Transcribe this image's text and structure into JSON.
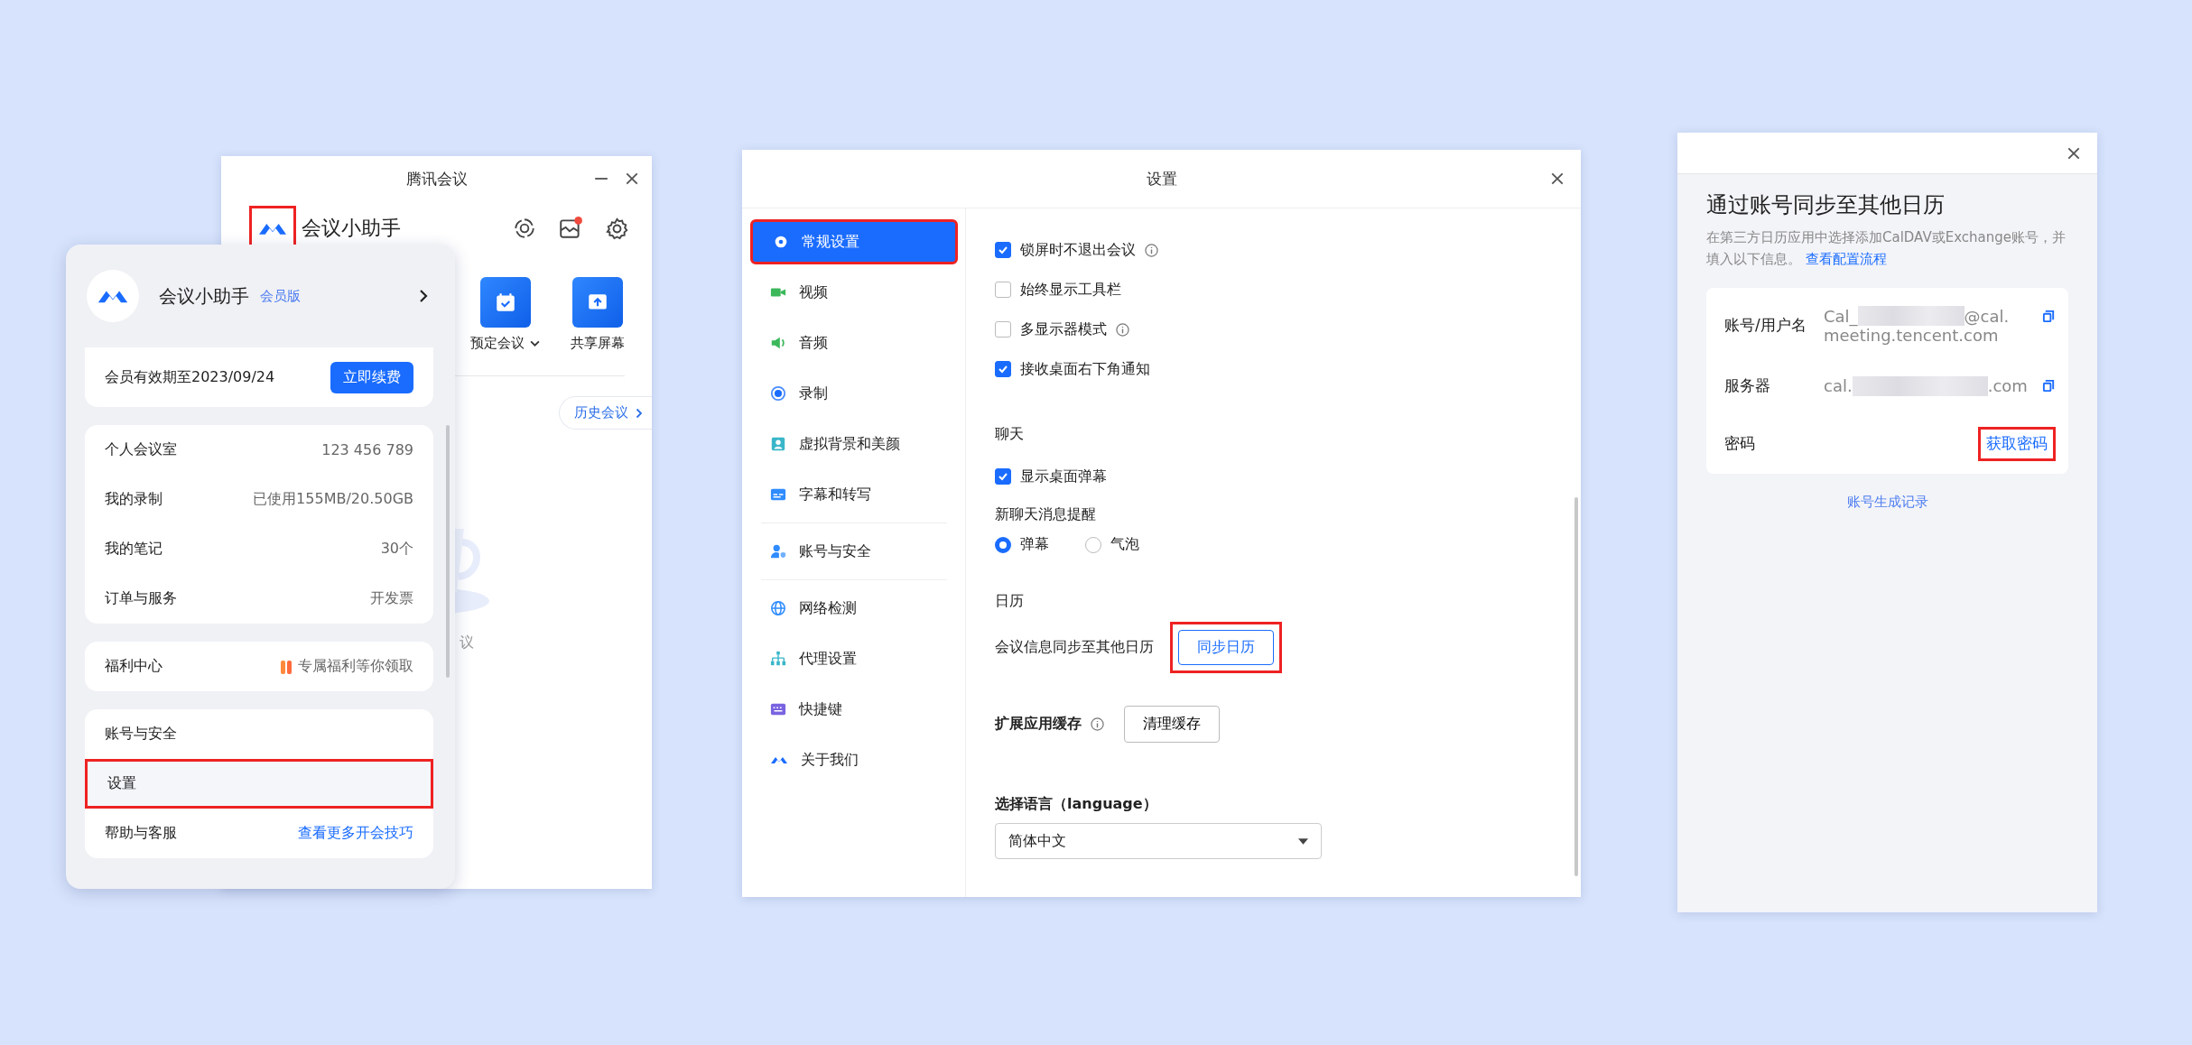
{
  "main_window": {
    "title": "腾讯会议",
    "logo_highlighted": true,
    "assistant_name": "会议小助手",
    "inbox_unread": true,
    "actions": [
      {
        "label": "预定会议",
        "dropdown": true
      },
      {
        "label": "共享屏幕",
        "dropdown": false
      }
    ],
    "history_button": "历史会议",
    "empty_hint": "议"
  },
  "account_popup": {
    "name": "会议小助手",
    "badge": "会员版",
    "membership": "会员有效期至2023/09/24",
    "renew_button": "立即续费",
    "groups": [
      {
        "rows": [
          {
            "label": "个人会议室",
            "value": "123 456 789",
            "kind": "plain",
            "highlighted": false
          },
          {
            "label": "我的录制",
            "value": "已使用155MB/20.50GB",
            "kind": "plain",
            "highlighted": false
          },
          {
            "label": "我的笔记",
            "value": "30个",
            "kind": "plain",
            "highlighted": false
          },
          {
            "label": "订单与服务",
            "value": "开发票",
            "kind": "plain",
            "highlighted": false
          }
        ]
      },
      {
        "rows": [
          {
            "label": "福利中心",
            "value": "专属福利等你领取",
            "kind": "gift",
            "highlighted": false
          }
        ]
      },
      {
        "rows": [
          {
            "label": "账号与安全",
            "highlighted": false
          },
          {
            "label": "设置",
            "highlighted": true
          },
          {
            "label": "帮助与客服",
            "value": "查看更多开会技巧",
            "kind": "link",
            "highlighted": false
          }
        ]
      }
    ]
  },
  "settings_window": {
    "title": "设置",
    "nav_groups": [
      {
        "items": [
          {
            "label": "常规设置",
            "selected": true,
            "highlighted": true
          },
          {
            "label": "视频",
            "selected": false,
            "highlighted": false
          },
          {
            "label": "音频",
            "selected": false,
            "highlighted": false
          },
          {
            "label": "录制",
            "selected": false,
            "highlighted": false
          },
          {
            "label": "虚拟背景和美颜",
            "selected": false,
            "highlighted": false
          },
          {
            "label": "字幕和转写",
            "selected": false,
            "highlighted": false
          }
        ]
      },
      {
        "items": [
          {
            "label": "账号与安全",
            "selected": false,
            "highlighted": false
          }
        ]
      },
      {
        "items": [
          {
            "label": "网络检测",
            "selected": false,
            "highlighted": false
          },
          {
            "label": "代理设置",
            "selected": false,
            "highlighted": false
          },
          {
            "label": "快捷键",
            "selected": false,
            "highlighted": false
          },
          {
            "label": "关于我们",
            "selected": false,
            "highlighted": false
          }
        ]
      }
    ],
    "options": [
      {
        "label": "锁屏时不退出会议",
        "checked": true,
        "info": true
      },
      {
        "label": "始终显示工具栏",
        "checked": false,
        "info": false
      },
      {
        "label": "多显示器模式",
        "checked": false,
        "info": true
      },
      {
        "label": "接收桌面右下角通知",
        "checked": true,
        "info": false
      }
    ],
    "chat": {
      "heading": "聊天",
      "options": [
        {
          "label": "显示桌面弹幕",
          "checked": true,
          "info": false
        }
      ],
      "reminder_label": "新聊天消息提醒",
      "radios": [
        {
          "label": "弹幕",
          "selected": true
        },
        {
          "label": "气泡",
          "selected": false
        }
      ]
    },
    "calendar": {
      "heading": "日历",
      "text": "会议信息同步至其他日历",
      "button": "同步日历",
      "button_highlighted": true
    },
    "cache": {
      "label": "扩展应用缓存",
      "button": "清理缓存"
    },
    "language": {
      "label": "选择语言（language）",
      "value": "简体中文"
    }
  },
  "sync_window": {
    "heading": "通过账号同步至其他日历",
    "description": "在第三方日历应用中选择添加CalDAV或Exchange账号，并填入以下信息。",
    "link": "查看配置流程",
    "account": {
      "label": "账号/用户名",
      "value_start": "Cal_",
      "value_end": "@cal.",
      "value_line2": "meeting.tencent.com"
    },
    "server": {
      "label": "服务器",
      "value_start": "cal.",
      "value_end": ".com"
    },
    "password": {
      "label": "密码",
      "link": "获取密码",
      "highlighted": true
    },
    "footer_link": "账号生成记录"
  }
}
